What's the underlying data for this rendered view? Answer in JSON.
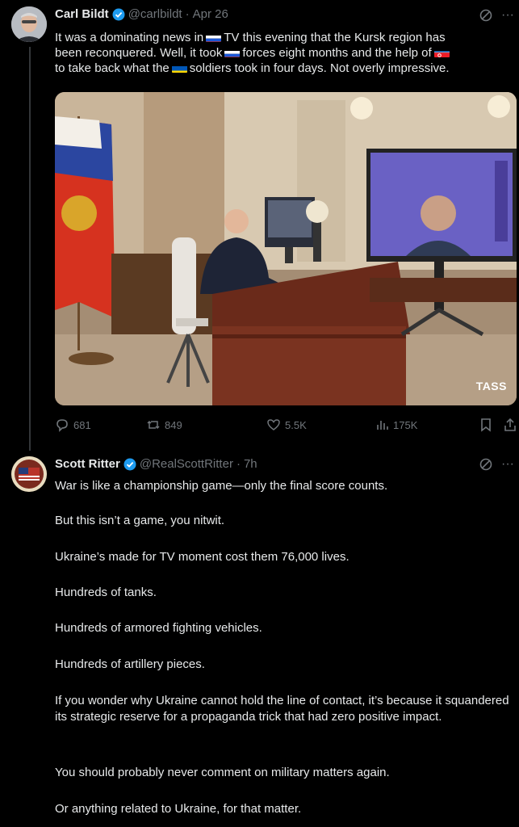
{
  "tweet1": {
    "name": "Carl Bildt",
    "handle": "@carlbildt",
    "time": "Apr 26",
    "text_a": "It was a dominating news in",
    "text_b": "TV this evening that the Kursk region has",
    "text_c": "been reconquered. Well, it took",
    "text_d": "forces eight months and the help of",
    "text_e": "to take back what the",
    "text_f": "soldiers took in four days. Not overly impressive.",
    "photo_watermark": "TASS",
    "stats": {
      "replies": "681",
      "reposts": "849",
      "likes": "5.5K",
      "views": "175K"
    }
  },
  "tweet2": {
    "name": "Scott Ritter",
    "handle": "@RealScottRitter",
    "time": "7h",
    "paragraphs": [
      "War is like a championship game—only the final score counts.",
      "But this isn’t a game, you nitwit.",
      "Ukraine’s made for TV moment cost them 76,000 lives.",
      "Hundreds of tanks.",
      "Hundreds of armored fighting vehicles.",
      "Hundreds of artillery pieces.",
      "If you wonder why Ukraine cannot hold the line of contact, it’s because it squandered its strategic reserve for a propaganda trick that had zero positive impact.",
      "You should probably never comment on military matters again.",
      "Or anything related to Ukraine, for that matter."
    ]
  },
  "colors": {
    "background": "#000000",
    "text": "#e7e9ea",
    "muted": "#71767b",
    "verified": "#1d9bf0"
  }
}
